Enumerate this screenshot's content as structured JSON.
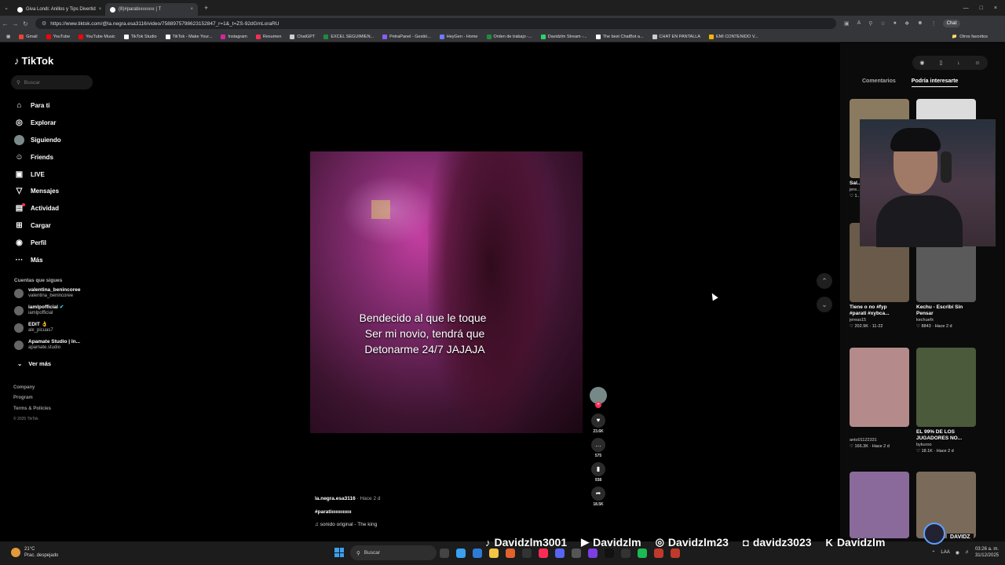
{
  "browser": {
    "tabs": [
      {
        "title": "Giva Londi: Anillos y Tips Divertid"
      },
      {
        "title": "(8)#paratiıııııııııııı | T"
      }
    ],
    "url": "https://www.tiktok.com/@la.negra.esa3116/video/7588975798623152847_r=1&_t=ZS-92dGmLoraRU",
    "chat_label": "Chat",
    "bookmarks": [
      {
        "label": "Gmail",
        "color": "#ea4335"
      },
      {
        "label": "YouTube",
        "color": "#ff0000"
      },
      {
        "label": "YouTube Music",
        "color": "#ff0000"
      },
      {
        "label": "TikTok Studio",
        "color": "#ffffff"
      },
      {
        "label": "TikTok - Make Your...",
        "color": "#ffffff"
      },
      {
        "label": "Instagram",
        "color": "#d6249f"
      },
      {
        "label": "Resumen",
        "color": "#fe2c55"
      },
      {
        "label": "ChatGPT",
        "color": "#cccccc"
      },
      {
        "label": "EXCEL SEGUIMIEN...",
        "color": "#1e8e3e"
      },
      {
        "label": "PetraPanel - Gestió...",
        "color": "#8a5cff"
      },
      {
        "label": "HeyGen - Home",
        "color": "#6b7cff"
      },
      {
        "label": "Orden de trabajo -...",
        "color": "#1e8e3e"
      },
      {
        "label": "Davidzlm Stream -...",
        "color": "#2bd46b"
      },
      {
        "label": "The best ChatBot a...",
        "color": "#ffffff"
      },
      {
        "label": "CHAT EN PANTALLA",
        "color": "#cccccc"
      },
      {
        "label": "EMI CONTENIDO V...",
        "color": "#f4b400"
      }
    ],
    "other_bookmarks": "Otros favoritos"
  },
  "sidebar": {
    "logo": "TikTok",
    "search_placeholder": "Buscar",
    "items": [
      {
        "label": "Para ti",
        "icon": "⌂"
      },
      {
        "label": "Explorar",
        "icon": "◎"
      },
      {
        "label": "Siguiendo",
        "icon": ""
      },
      {
        "label": "Friends",
        "icon": "☺"
      },
      {
        "label": "LIVE",
        "icon": "▣"
      },
      {
        "label": "Mensajes",
        "icon": "▽"
      },
      {
        "label": "Actividad",
        "icon": "▤"
      },
      {
        "label": "Cargar",
        "icon": "⊞"
      },
      {
        "label": "Perfil",
        "icon": "◉"
      },
      {
        "label": "Más",
        "icon": "···"
      }
    ],
    "following_title": "Cuentas que sigues",
    "following": [
      {
        "name": "valentina_benincoree",
        "user": "valentina_benincoree"
      },
      {
        "name": "iamlpofficial",
        "user": "iamlpofficial"
      },
      {
        "name": "EDIT 👌",
        "user": "alx_picuas7"
      },
      {
        "name": "Apamate Studio | In...",
        "user": "apamate.studio"
      }
    ],
    "see_more": "Ver más",
    "footer": [
      "Company",
      "Program",
      "Terms & Policies"
    ],
    "copyright": "© 2025 TikTok"
  },
  "video": {
    "caption_lines": [
      "Bendecido al que le toque",
      "Ser mi novio, tendrá que",
      "Detonarme 24/7 JAJAJA"
    ],
    "author": "la.negra.esa3116",
    "time": "· Hace 2 d",
    "tags": "#paratiıııııııııııııı",
    "sound": "sonido original - The king",
    "likes": "23.6K",
    "comments": "575",
    "saves": "938",
    "shares": "18.5K"
  },
  "right_panel": {
    "tabs": [
      "Comentarios",
      "Podría interesarte"
    ],
    "cards": [
      {
        "title": "Sal...\n#fy...",
        "user": "jere...",
        "stats": "♡ 1...",
        "color": "#8a7a60"
      },
      {
        "title": "",
        "user": "",
        "stats": "",
        "color": "#dcdcdc"
      },
      {
        "title": "Tiene o no #fyp\n#parati #xybca...",
        "user": "jereas15",
        "stats": "♡ 202.9K · 11-22",
        "color": "#6a5a4a"
      },
      {
        "title": "Kechu - Escribí Sin\nPensar",
        "user": "kechuefx",
        "stats": "♡ 8843 · Hace 2 d",
        "color": "#5a5a5a"
      },
      {
        "title": "",
        "user": "anto01122331",
        "stats": "♡ 166.3K · Hace 2 d",
        "color": "#b48a8a"
      },
      {
        "title": "EL 99% DE LOS\nJUGADORES NO...",
        "user": "bykuroo",
        "stats": "♡ 18.1K · Hace 2 d",
        "color": "#4a5a3a"
      },
      {
        "title": "",
        "user": "",
        "stats": "",
        "color": "#8a6a9a"
      },
      {
        "title": "",
        "user": "",
        "stats": "",
        "color": "#7a6a5a"
      }
    ]
  },
  "overlay": {
    "social": [
      {
        "glyph": "♪",
        "handle": "Davidzlm3001"
      },
      {
        "glyph": "▶",
        "handle": "Davidzlm"
      },
      {
        "glyph": "◎",
        "handle": "Davidzlm23"
      },
      {
        "glyph": "◘",
        "handle": "davidz3023"
      },
      {
        "glyph": "K",
        "handle": "Davidzlm"
      }
    ],
    "brand": "DAVIDZ"
  },
  "taskbar": {
    "temp": "21°C",
    "weather": "Prac. despejado",
    "search_placeholder": "Buscar",
    "lang": "LAA",
    "time": "03:26 a. m.",
    "date": "31/12/2025"
  }
}
